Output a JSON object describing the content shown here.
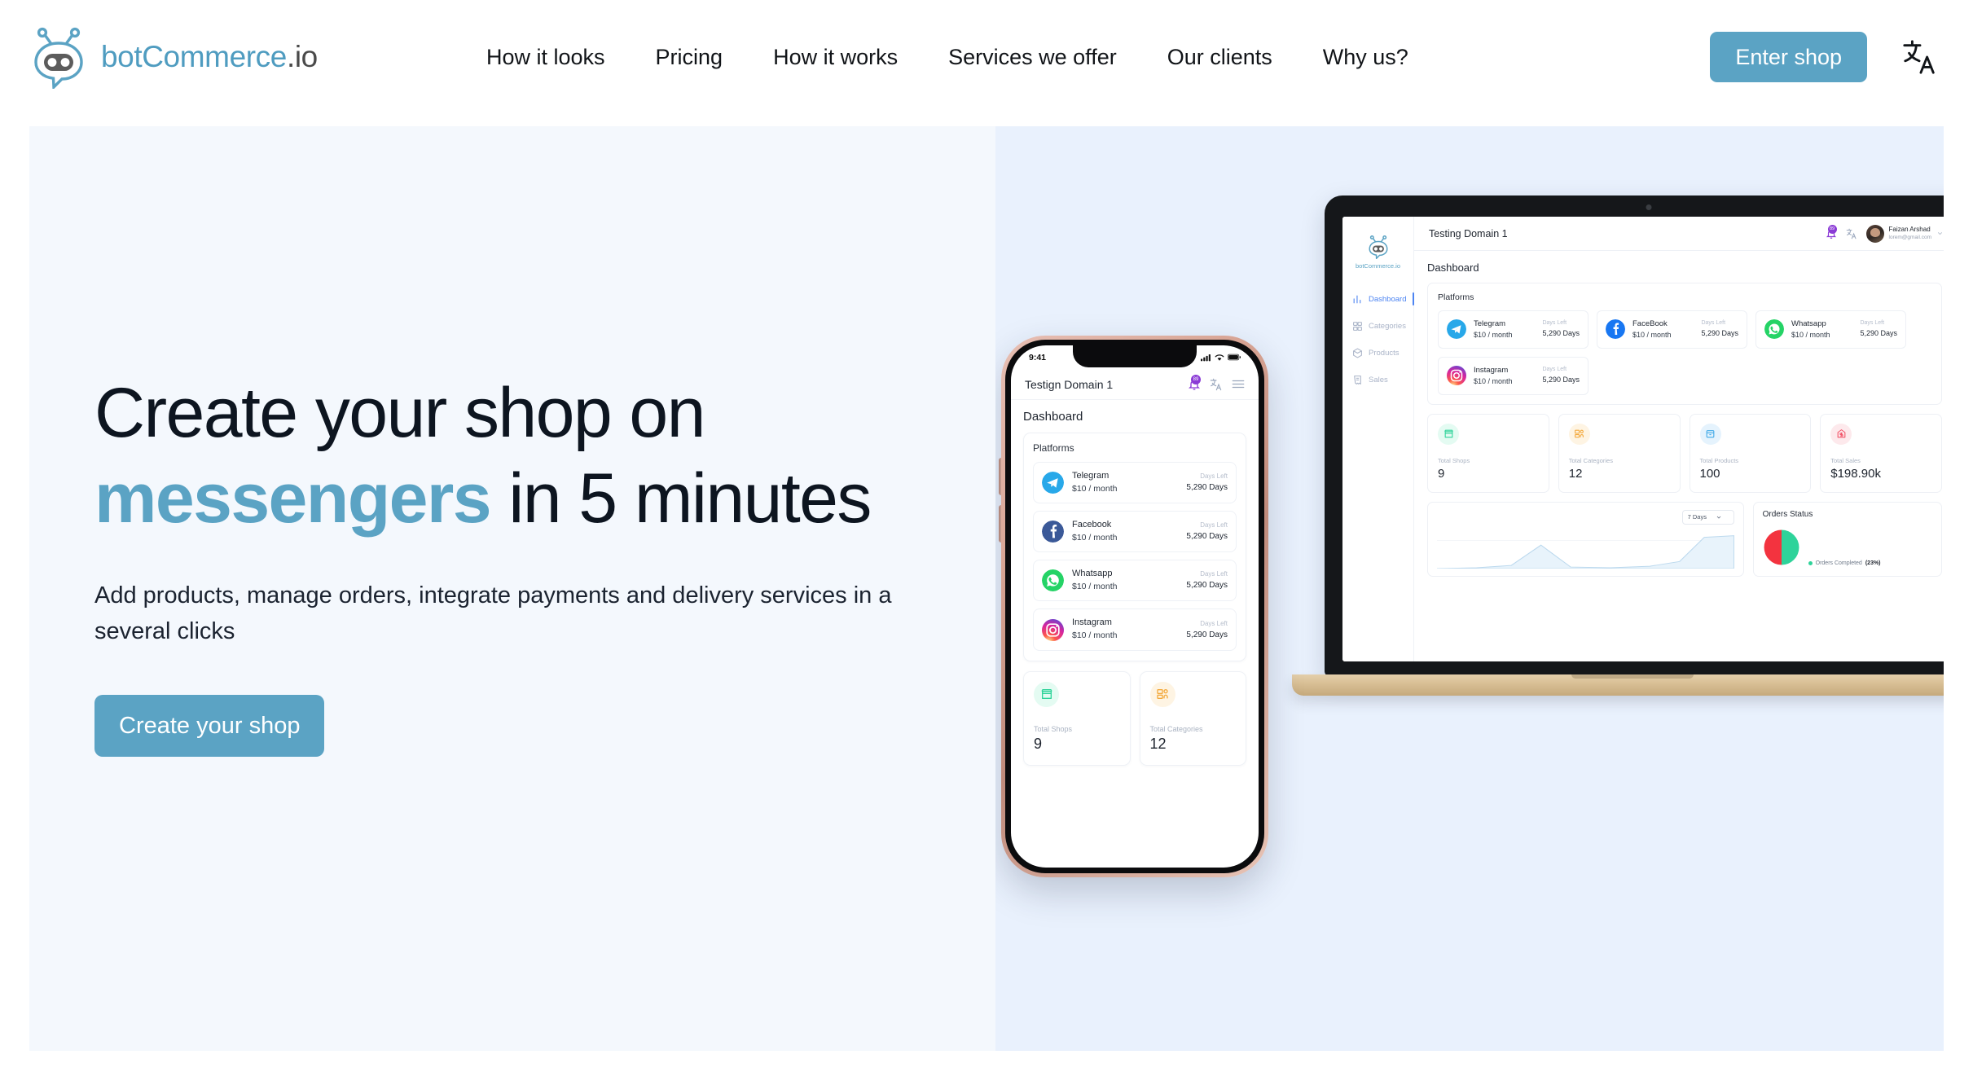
{
  "header": {
    "brand": {
      "name_primary": "botCommerce",
      "name_suffix": ".io",
      "logo_icon": "bot-logo-icon"
    },
    "nav": [
      {
        "label": "How it looks"
      },
      {
        "label": "Pricing"
      },
      {
        "label": "How it works"
      },
      {
        "label": "Services we offer"
      },
      {
        "label": "Our clients"
      },
      {
        "label": "Why us?"
      }
    ],
    "enter_shop_label": "Enter shop",
    "language_icon": "translate-icon"
  },
  "hero": {
    "title_part1": "Create your shop on ",
    "title_accent": "messengers",
    "title_part2": " in 5 minutes",
    "subtitle": "Add products, manage orders, integrate payments and delivery services in a several clicks",
    "cta_label": "Create your shop",
    "accent_color": "#5ba3c4",
    "bg_left": "#f4f8fd",
    "bg_right": "#e9f1fd"
  },
  "laptop_dashboard": {
    "sidebar": {
      "logo_text": "botCommerce.io",
      "items": [
        {
          "label": "Dashboard",
          "icon": "chart-bars-icon",
          "active": true
        },
        {
          "label": "Categories",
          "icon": "categories-icon",
          "active": false
        },
        {
          "label": "Products",
          "icon": "box-icon",
          "active": false
        },
        {
          "label": "Sales",
          "icon": "receipt-icon",
          "active": false
        }
      ]
    },
    "topbar": {
      "domain": "Testing Domain 1",
      "notification_count": "89",
      "translate_icon": "translate-icon",
      "user_name": "Faizan Arshad",
      "user_email": "lorem@gmail.com"
    },
    "page_title": "Dashboard",
    "platforms_title": "Platforms",
    "platforms": [
      {
        "name": "Telegram",
        "price": "$10 / month",
        "days_left_label": "Days Left",
        "days_left": "5,290 Days",
        "color": "#28a8e9"
      },
      {
        "name": "FaceBook",
        "price": "$10 / month",
        "days_left_label": "Days Left",
        "days_left": "5,290 Days",
        "color": "#1877f2"
      },
      {
        "name": "Whatsapp",
        "price": "$10 / month",
        "days_left_label": "Days Left",
        "days_left": "5,290 Days",
        "color": "#25d366"
      },
      {
        "name": "Instagram",
        "price": "$10 / month",
        "days_left_label": "Days Left",
        "days_left": "5,290 Days",
        "color": "#e1306c"
      }
    ],
    "stats": [
      {
        "label": "Total Shops",
        "value": "9",
        "icon": "store-icon",
        "color": "#2fd39a",
        "bg": "#e4fbf2"
      },
      {
        "label": "Total Categories",
        "value": "12",
        "icon": "categories-icon",
        "color": "#f3a93c",
        "bg": "#fef4e3"
      },
      {
        "label": "Total Products",
        "value": "100",
        "icon": "box-icon",
        "color": "#3fa9e8",
        "bg": "#e5f3fd"
      },
      {
        "label": "Total Sales",
        "value": "$198.90k",
        "icon": "sales-icon",
        "color": "#f2556a",
        "bg": "#fde9ec"
      }
    ],
    "chart_range_label": "7 Days",
    "orders_status_title": "Orders Status",
    "orders_legend_label": "Orders Completed",
    "orders_legend_pct": "(23%)"
  },
  "phone_dashboard": {
    "status_time": "9:41",
    "domain": "Testign Domain 1",
    "notification_count": "89",
    "translate_icon": "translate-icon",
    "menu_icon": "hamburger-menu-icon",
    "page_title": "Dashboard",
    "platforms_title": "Platforms",
    "platforms": [
      {
        "name": "Telegram",
        "price": "$10 / month",
        "days_left_label": "Days Left",
        "days_left": "5,290 Days"
      },
      {
        "name": "Facebook",
        "price": "$10 / month",
        "days_left_label": "Days Left",
        "days_left": "5,290 Days"
      },
      {
        "name": "Whatsapp",
        "price": "$10 / month",
        "days_left_label": "Days Left",
        "days_left": "5,290 Days"
      },
      {
        "name": "Instagram",
        "price": "$10 / month",
        "days_left_label": "Days Left",
        "days_left": "5,290 Days"
      }
    ],
    "stats": [
      {
        "label": "Total Shops",
        "value": "9",
        "icon": "store-icon"
      },
      {
        "label": "Total Categories",
        "value": "12",
        "icon": "categories-icon"
      }
    ]
  }
}
